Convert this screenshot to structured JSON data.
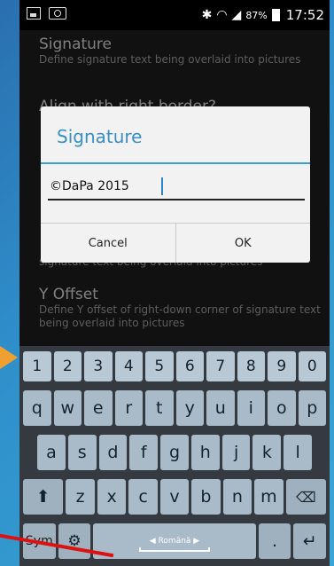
{
  "status_bar": {
    "battery": "87%",
    "time": "17:52"
  },
  "settings": [
    {
      "title": "Signature",
      "summary": "Define signature text being overlaid into pictures"
    },
    {
      "title": "Align with right border?",
      "summary": ""
    },
    {
      "title": "",
      "summary": "signature text being overlaid into pictures"
    },
    {
      "title": "Y Offset",
      "summary": "Define Y offset of right-down corner of signature text being overlaid into pictures"
    }
  ],
  "dialog": {
    "title": "Signature",
    "input_value": "©DaPa 2015",
    "cancel_label": "Cancel",
    "ok_label": "OK"
  },
  "keyboard": {
    "numbers": [
      "1",
      "2",
      "3",
      "4",
      "5",
      "6",
      "7",
      "8",
      "9",
      "0"
    ],
    "row1": [
      "q",
      "w",
      "e",
      "r",
      "t",
      "y",
      "u",
      "i",
      "o",
      "p"
    ],
    "row2": [
      "a",
      "s",
      "d",
      "f",
      "g",
      "h",
      "j",
      "k",
      "l"
    ],
    "row3": [
      "z",
      "x",
      "c",
      "v",
      "b",
      "n",
      "m"
    ],
    "sym_label": "Sym",
    "space_label": "Română",
    "period_label": "."
  }
}
